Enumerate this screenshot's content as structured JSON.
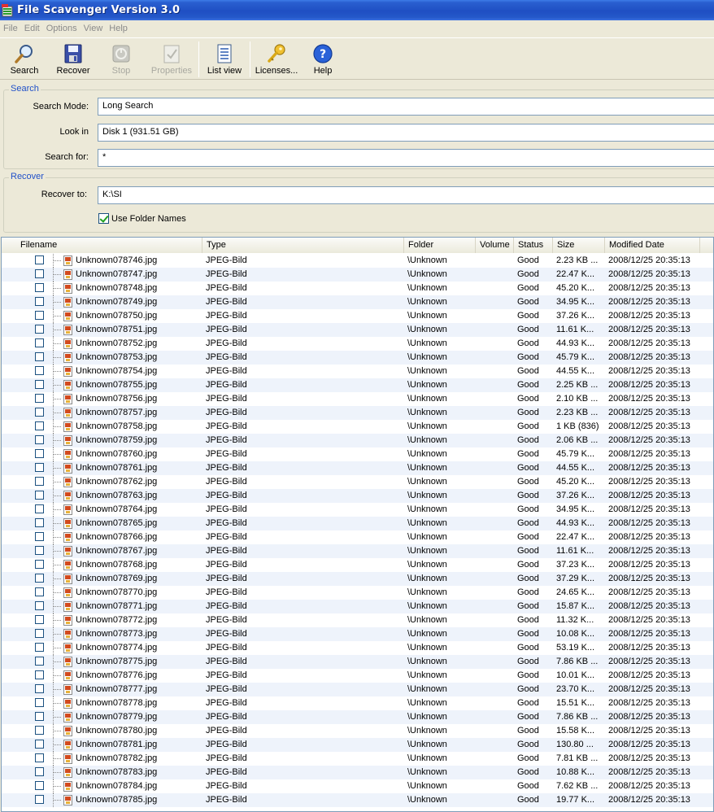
{
  "window": {
    "title": "File Scavenger Version 3.0"
  },
  "menu": [
    "File",
    "Edit",
    "Options",
    "View",
    "Help"
  ],
  "toolbar": {
    "search": "Search",
    "recover": "Recover",
    "stop": "Stop",
    "properties": "Properties",
    "list_view": "List view",
    "licenses": "Licenses...",
    "help": "Help"
  },
  "search_group": {
    "title": "Search",
    "mode_label": "Search Mode:",
    "mode_value": "Long Search",
    "look_in_label": "Look in",
    "look_in_value": "Disk 1 (931.51 GB)",
    "search_for_label": "Search for:",
    "search_for_value": "*"
  },
  "recover_group": {
    "title": "Recover",
    "recover_to_label": "Recover to:",
    "recover_to_value": "K:\\SI",
    "use_folder_names": "Use Folder Names"
  },
  "list": {
    "columns": [
      "Filename",
      "Type",
      "Folder",
      "Volume",
      "Status",
      "Size",
      "Modified Date"
    ],
    "rows": [
      {
        "name": "Unknown078746.jpg",
        "type": "JPEG-Bild",
        "folder": "\\Unknown",
        "volume": "",
        "status": "Good",
        "size": "2.23 KB ...",
        "date": "2008/12/25 20:35:13"
      },
      {
        "name": "Unknown078747.jpg",
        "type": "JPEG-Bild",
        "folder": "\\Unknown",
        "volume": "",
        "status": "Good",
        "size": "22.47 K...",
        "date": "2008/12/25 20:35:13"
      },
      {
        "name": "Unknown078748.jpg",
        "type": "JPEG-Bild",
        "folder": "\\Unknown",
        "volume": "",
        "status": "Good",
        "size": "45.20 K...",
        "date": "2008/12/25 20:35:13"
      },
      {
        "name": "Unknown078749.jpg",
        "type": "JPEG-Bild",
        "folder": "\\Unknown",
        "volume": "",
        "status": "Good",
        "size": "34.95 K...",
        "date": "2008/12/25 20:35:13"
      },
      {
        "name": "Unknown078750.jpg",
        "type": "JPEG-Bild",
        "folder": "\\Unknown",
        "volume": "",
        "status": "Good",
        "size": "37.26 K...",
        "date": "2008/12/25 20:35:13"
      },
      {
        "name": "Unknown078751.jpg",
        "type": "JPEG-Bild",
        "folder": "\\Unknown",
        "volume": "",
        "status": "Good",
        "size": "11.61 K...",
        "date": "2008/12/25 20:35:13"
      },
      {
        "name": "Unknown078752.jpg",
        "type": "JPEG-Bild",
        "folder": "\\Unknown",
        "volume": "",
        "status": "Good",
        "size": "44.93 K...",
        "date": "2008/12/25 20:35:13"
      },
      {
        "name": "Unknown078753.jpg",
        "type": "JPEG-Bild",
        "folder": "\\Unknown",
        "volume": "",
        "status": "Good",
        "size": "45.79 K...",
        "date": "2008/12/25 20:35:13"
      },
      {
        "name": "Unknown078754.jpg",
        "type": "JPEG-Bild",
        "folder": "\\Unknown",
        "volume": "",
        "status": "Good",
        "size": "44.55 K...",
        "date": "2008/12/25 20:35:13"
      },
      {
        "name": "Unknown078755.jpg",
        "type": "JPEG-Bild",
        "folder": "\\Unknown",
        "volume": "",
        "status": "Good",
        "size": "2.25 KB ...",
        "date": "2008/12/25 20:35:13"
      },
      {
        "name": "Unknown078756.jpg",
        "type": "JPEG-Bild",
        "folder": "\\Unknown",
        "volume": "",
        "status": "Good",
        "size": "2.10 KB ...",
        "date": "2008/12/25 20:35:13"
      },
      {
        "name": "Unknown078757.jpg",
        "type": "JPEG-Bild",
        "folder": "\\Unknown",
        "volume": "",
        "status": "Good",
        "size": "2.23 KB ...",
        "date": "2008/12/25 20:35:13"
      },
      {
        "name": "Unknown078758.jpg",
        "type": "JPEG-Bild",
        "folder": "\\Unknown",
        "volume": "",
        "status": "Good",
        "size": "1 KB (836)",
        "date": "2008/12/25 20:35:13"
      },
      {
        "name": "Unknown078759.jpg",
        "type": "JPEG-Bild",
        "folder": "\\Unknown",
        "volume": "",
        "status": "Good",
        "size": "2.06 KB ...",
        "date": "2008/12/25 20:35:13"
      },
      {
        "name": "Unknown078760.jpg",
        "type": "JPEG-Bild",
        "folder": "\\Unknown",
        "volume": "",
        "status": "Good",
        "size": "45.79 K...",
        "date": "2008/12/25 20:35:13"
      },
      {
        "name": "Unknown078761.jpg",
        "type": "JPEG-Bild",
        "folder": "\\Unknown",
        "volume": "",
        "status": "Good",
        "size": "44.55 K...",
        "date": "2008/12/25 20:35:13"
      },
      {
        "name": "Unknown078762.jpg",
        "type": "JPEG-Bild",
        "folder": "\\Unknown",
        "volume": "",
        "status": "Good",
        "size": "45.20 K...",
        "date": "2008/12/25 20:35:13"
      },
      {
        "name": "Unknown078763.jpg",
        "type": "JPEG-Bild",
        "folder": "\\Unknown",
        "volume": "",
        "status": "Good",
        "size": "37.26 K...",
        "date": "2008/12/25 20:35:13"
      },
      {
        "name": "Unknown078764.jpg",
        "type": "JPEG-Bild",
        "folder": "\\Unknown",
        "volume": "",
        "status": "Good",
        "size": "34.95 K...",
        "date": "2008/12/25 20:35:13"
      },
      {
        "name": "Unknown078765.jpg",
        "type": "JPEG-Bild",
        "folder": "\\Unknown",
        "volume": "",
        "status": "Good",
        "size": "44.93 K...",
        "date": "2008/12/25 20:35:13"
      },
      {
        "name": "Unknown078766.jpg",
        "type": "JPEG-Bild",
        "folder": "\\Unknown",
        "volume": "",
        "status": "Good",
        "size": "22.47 K...",
        "date": "2008/12/25 20:35:13"
      },
      {
        "name": "Unknown078767.jpg",
        "type": "JPEG-Bild",
        "folder": "\\Unknown",
        "volume": "",
        "status": "Good",
        "size": "11.61 K...",
        "date": "2008/12/25 20:35:13"
      },
      {
        "name": "Unknown078768.jpg",
        "type": "JPEG-Bild",
        "folder": "\\Unknown",
        "volume": "",
        "status": "Good",
        "size": "37.23 K...",
        "date": "2008/12/25 20:35:13"
      },
      {
        "name": "Unknown078769.jpg",
        "type": "JPEG-Bild",
        "folder": "\\Unknown",
        "volume": "",
        "status": "Good",
        "size": "37.29 K...",
        "date": "2008/12/25 20:35:13"
      },
      {
        "name": "Unknown078770.jpg",
        "type": "JPEG-Bild",
        "folder": "\\Unknown",
        "volume": "",
        "status": "Good",
        "size": "24.65 K...",
        "date": "2008/12/25 20:35:13"
      },
      {
        "name": "Unknown078771.jpg",
        "type": "JPEG-Bild",
        "folder": "\\Unknown",
        "volume": "",
        "status": "Good",
        "size": "15.87 K...",
        "date": "2008/12/25 20:35:13"
      },
      {
        "name": "Unknown078772.jpg",
        "type": "JPEG-Bild",
        "folder": "\\Unknown",
        "volume": "",
        "status": "Good",
        "size": "11.32 K...",
        "date": "2008/12/25 20:35:13"
      },
      {
        "name": "Unknown078773.jpg",
        "type": "JPEG-Bild",
        "folder": "\\Unknown",
        "volume": "",
        "status": "Good",
        "size": "10.08 K...",
        "date": "2008/12/25 20:35:13"
      },
      {
        "name": "Unknown078774.jpg",
        "type": "JPEG-Bild",
        "folder": "\\Unknown",
        "volume": "",
        "status": "Good",
        "size": "53.19 K...",
        "date": "2008/12/25 20:35:13"
      },
      {
        "name": "Unknown078775.jpg",
        "type": "JPEG-Bild",
        "folder": "\\Unknown",
        "volume": "",
        "status": "Good",
        "size": "7.86 KB ...",
        "date": "2008/12/25 20:35:13"
      },
      {
        "name": "Unknown078776.jpg",
        "type": "JPEG-Bild",
        "folder": "\\Unknown",
        "volume": "",
        "status": "Good",
        "size": "10.01 K...",
        "date": "2008/12/25 20:35:13"
      },
      {
        "name": "Unknown078777.jpg",
        "type": "JPEG-Bild",
        "folder": "\\Unknown",
        "volume": "",
        "status": "Good",
        "size": "23.70 K...",
        "date": "2008/12/25 20:35:13"
      },
      {
        "name": "Unknown078778.jpg",
        "type": "JPEG-Bild",
        "folder": "\\Unknown",
        "volume": "",
        "status": "Good",
        "size": "15.51 K...",
        "date": "2008/12/25 20:35:13"
      },
      {
        "name": "Unknown078779.jpg",
        "type": "JPEG-Bild",
        "folder": "\\Unknown",
        "volume": "",
        "status": "Good",
        "size": "7.86 KB ...",
        "date": "2008/12/25 20:35:13"
      },
      {
        "name": "Unknown078780.jpg",
        "type": "JPEG-Bild",
        "folder": "\\Unknown",
        "volume": "",
        "status": "Good",
        "size": "15.58 K...",
        "date": "2008/12/25 20:35:13"
      },
      {
        "name": "Unknown078781.jpg",
        "type": "JPEG-Bild",
        "folder": "\\Unknown",
        "volume": "",
        "status": "Good",
        "size": "130.80 ...",
        "date": "2008/12/25 20:35:13"
      },
      {
        "name": "Unknown078782.jpg",
        "type": "JPEG-Bild",
        "folder": "\\Unknown",
        "volume": "",
        "status": "Good",
        "size": "7.81 KB ...",
        "date": "2008/12/25 20:35:13"
      },
      {
        "name": "Unknown078783.jpg",
        "type": "JPEG-Bild",
        "folder": "\\Unknown",
        "volume": "",
        "status": "Good",
        "size": "10.88 K...",
        "date": "2008/12/25 20:35:13"
      },
      {
        "name": "Unknown078784.jpg",
        "type": "JPEG-Bild",
        "folder": "\\Unknown",
        "volume": "",
        "status": "Good",
        "size": "7.62 KB ...",
        "date": "2008/12/25 20:35:13"
      },
      {
        "name": "Unknown078785.jpg",
        "type": "JPEG-Bild",
        "folder": "\\Unknown",
        "volume": "",
        "status": "Good",
        "size": "19.77 K...",
        "date": "2008/12/25 20:35:13"
      }
    ]
  }
}
